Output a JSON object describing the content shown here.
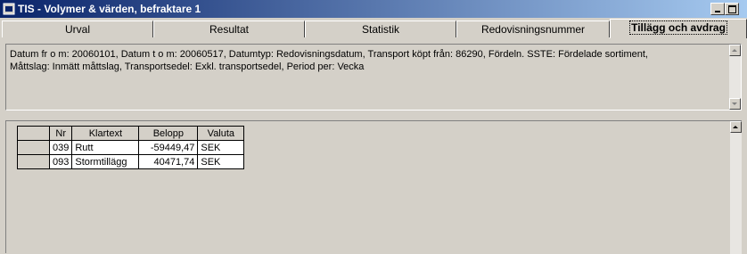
{
  "window": {
    "title": "TIS - Volymer & värden, befraktare 1",
    "icon": "app-icon",
    "minimize_icon": "minimize-icon",
    "maximize_icon": "maximize-icon"
  },
  "tabs": [
    {
      "label": "Urval",
      "active": false
    },
    {
      "label": "Resultat",
      "active": false
    },
    {
      "label": "Statistik",
      "active": false
    },
    {
      "label": "Redovisningsnummer",
      "active": false
    },
    {
      "label": "Tillägg och avdrag",
      "active": true
    }
  ],
  "info": {
    "line1": "Datum fr o m: 20060101,  Datum t o m: 20060517,  Datumtyp: Redovisningsdatum,  Transport köpt från: 86290,   Fördeln. SSTE: Fördelade sortiment,",
    "line2": "Måttslag: Inmätt måttslag,  Transportsedel: Exkl. transportsedel,  Period per: Vecka"
  },
  "grid": {
    "columns": [
      "Nr",
      "Klartext",
      "Belopp",
      "Valuta"
    ],
    "rows": [
      {
        "nr": "039",
        "klartext": "Rutt",
        "belopp": "-59449,47",
        "valuta": "SEK"
      },
      {
        "nr": "093",
        "klartext": "Stormtillägg",
        "belopp": "40471,74",
        "valuta": "SEK"
      }
    ]
  }
}
